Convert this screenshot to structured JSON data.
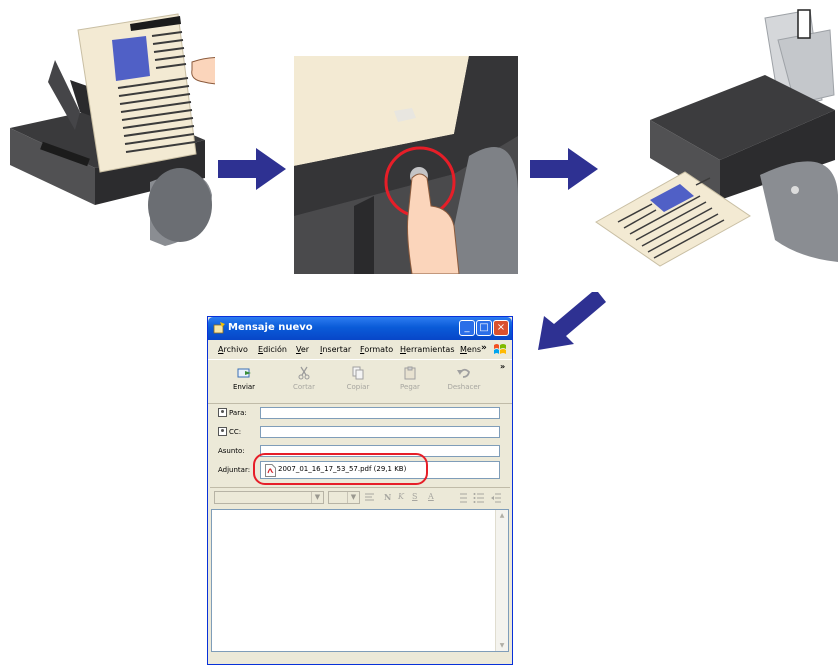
{
  "window": {
    "title": "Mensaje nuevo",
    "controls": {
      "minimize": "_",
      "maximize": "□",
      "close": "×"
    }
  },
  "menu": {
    "items": [
      {
        "label": "Archivo",
        "mnemonic": "A",
        "rest": "rchivo"
      },
      {
        "label": "Edición",
        "mnemonic": "E",
        "rest": "dición"
      },
      {
        "label": "Ver",
        "mnemonic": "V",
        "rest": "er"
      },
      {
        "label": "Insertar",
        "mnemonic": "I",
        "rest": "nsertar"
      },
      {
        "label": "Formato",
        "mnemonic": "F",
        "rest": "ormato"
      },
      {
        "label": "Herramientas",
        "mnemonic": "H",
        "rest": "erramientas"
      },
      {
        "label": "Mens",
        "mnemonic": "M",
        "rest": "ens"
      }
    ],
    "overflow": "»"
  },
  "toolbar": {
    "send": "Enviar",
    "cut": "Cortar",
    "copy": "Copiar",
    "paste": "Pegar",
    "undo": "Deshacer",
    "overflow": "»"
  },
  "headers": {
    "to_label": "Para:",
    "cc_label": "CC:",
    "subject_label": "Asunto:",
    "attach_label": "Adjuntar:",
    "attachment": "2007_01_16_17_53_57.pdf (29,1 KB)"
  },
  "format_toolbar": {
    "bold": "N",
    "italic": "K",
    "underline": "S",
    "font_color": "A"
  },
  "colors": {
    "arrow": "#2e3192",
    "highlight": "#e61e28",
    "titlebar": "#0a5bd8"
  }
}
